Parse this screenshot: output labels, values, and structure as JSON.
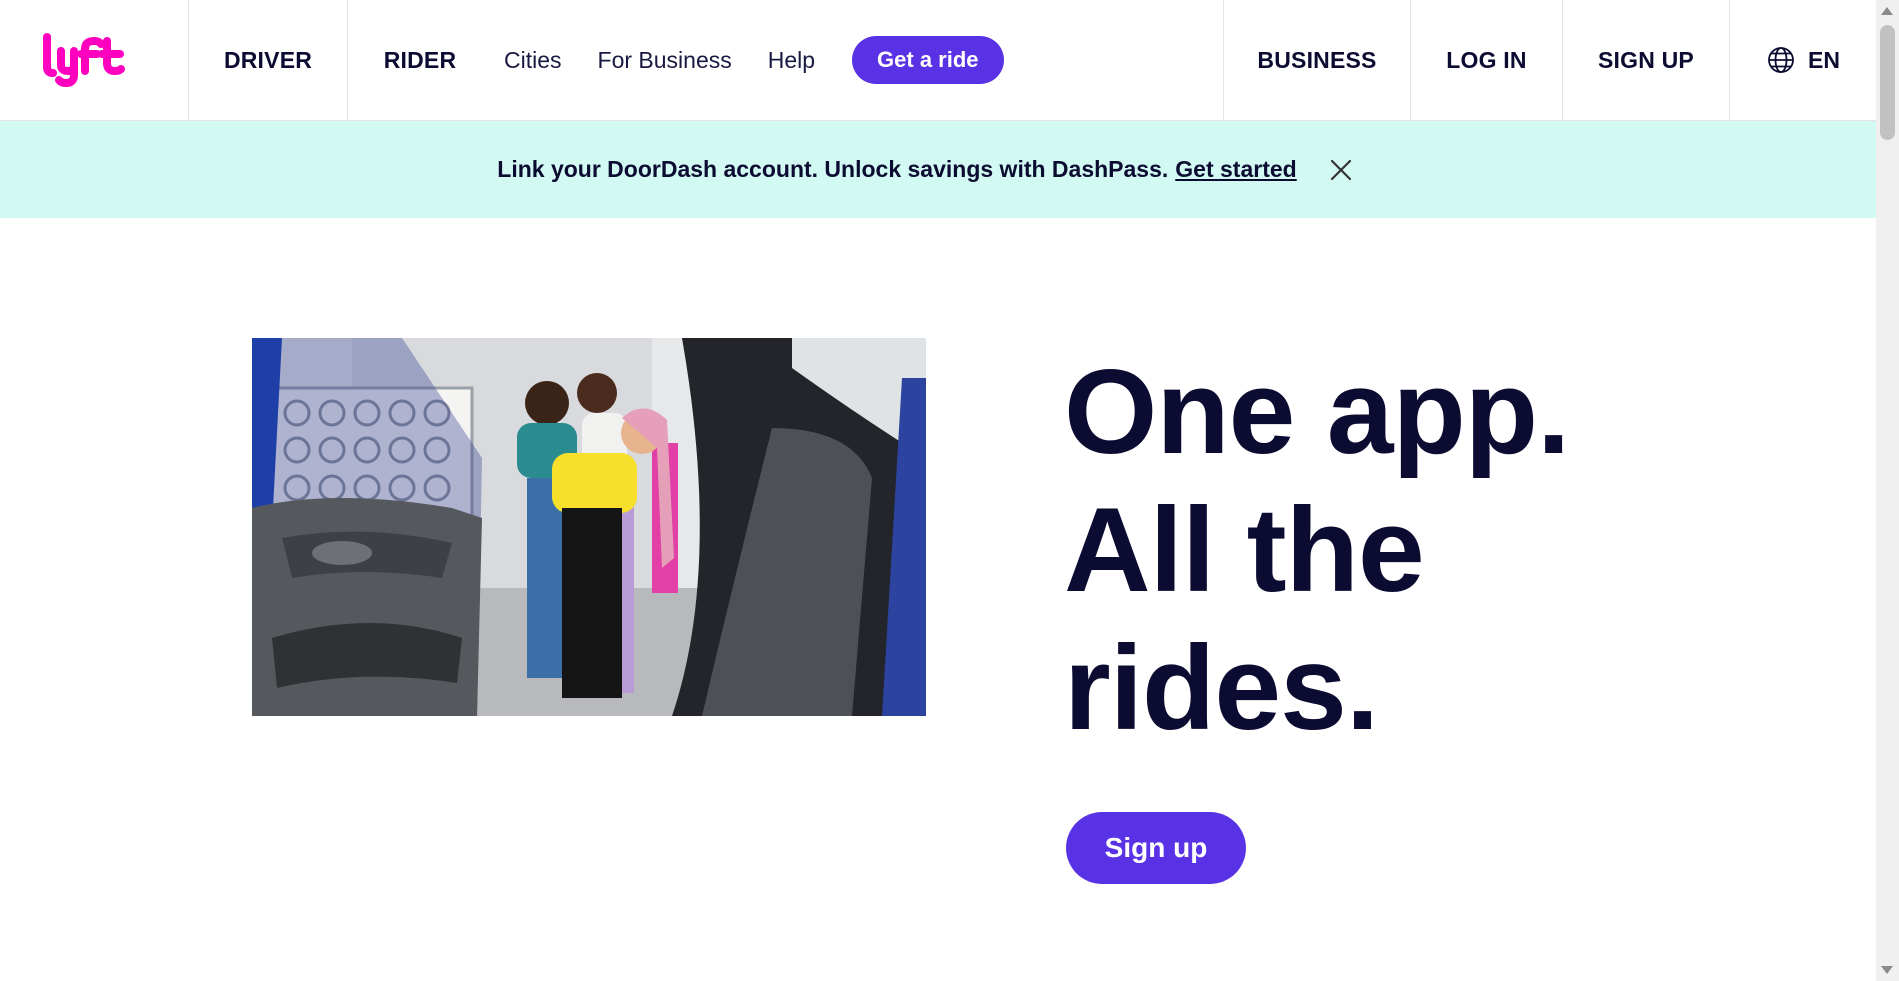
{
  "header": {
    "logo_text": "lyft",
    "nav_primary": [
      "DRIVER",
      "RIDER"
    ],
    "nav_secondary": [
      "Cities",
      "For Business",
      "Help"
    ],
    "cta_label": "Get a ride",
    "nav_right": [
      "BUSINESS",
      "LOG IN",
      "SIGN UP"
    ],
    "language": "EN",
    "language_icon": "globe-icon"
  },
  "banner": {
    "text": "Link your DoorDash account. Unlock savings with DashPass.",
    "link": "Get started",
    "close_icon": "close-icon"
  },
  "hero": {
    "headline_lines": [
      "One app.",
      "All the",
      "rides."
    ],
    "cta_label": "Sign up",
    "image_alt": "photo-of-friends-leaning-into-open-car-door"
  },
  "colors": {
    "brand_pink": "#ff00bf",
    "accent_purple": "#5a32e6",
    "text_navy": "#0c0b31",
    "banner_bg": "#d2faf3"
  }
}
